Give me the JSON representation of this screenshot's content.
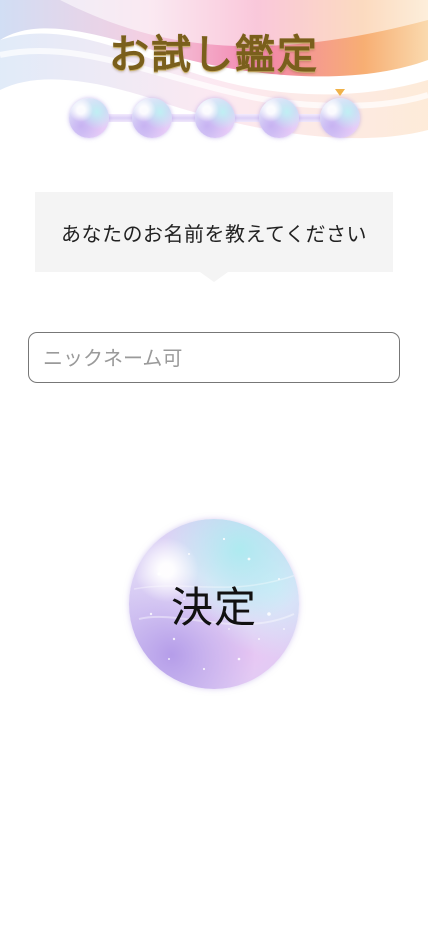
{
  "header": {
    "title": "お試し鑑定"
  },
  "progress": {
    "total_steps": 5,
    "current_step": 5
  },
  "question": {
    "text": "あなたのお名前を教えてください"
  },
  "name_field": {
    "value": "",
    "placeholder": "ニックネーム可"
  },
  "submit": {
    "label": "決定"
  },
  "colors": {
    "title": "#7a5f1c",
    "bubble_bg": "#f4f4f4",
    "marker": "#f0b24a"
  }
}
